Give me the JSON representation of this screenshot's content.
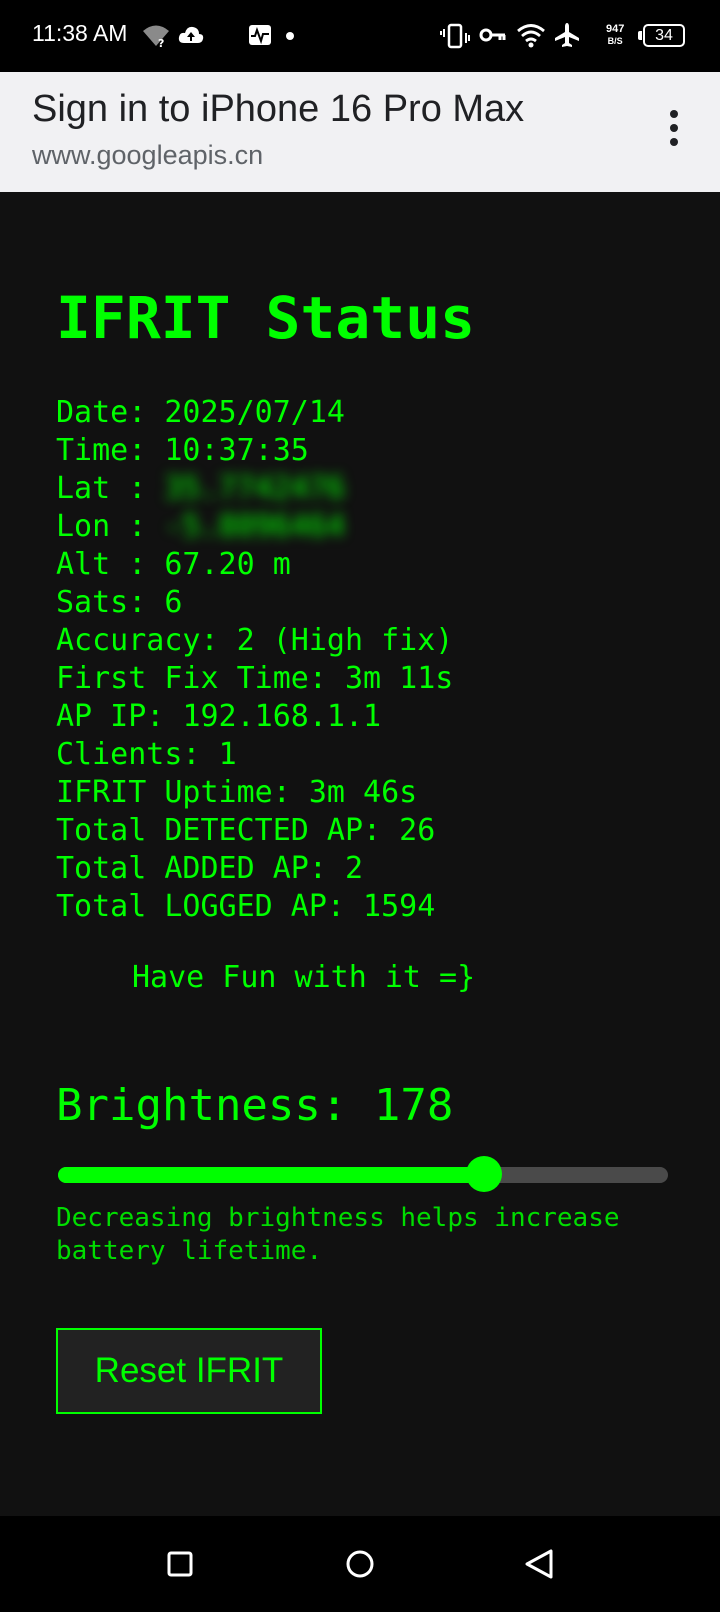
{
  "status_bar": {
    "time": "11:38 AM",
    "icons": [
      "wifi-question-icon",
      "cloud-upload-icon",
      "activity-icon",
      "dot-icon",
      "vibrate-icon",
      "vpn-key-icon",
      "wifi-icon",
      "airplane-icon"
    ],
    "net_speed_value": "947",
    "net_speed_unit": "B/S",
    "battery": "34"
  },
  "browser": {
    "title": "Sign in to iPhone 16 Pro Max",
    "url": "www.googleapis.cn",
    "menu_icon": "more-vert-icon"
  },
  "page": {
    "title": "IFRIT Status",
    "stats": [
      {
        "label": "Date: ",
        "value": "2025/07/14"
      },
      {
        "label": "Time: ",
        "value": "10:37:35"
      },
      {
        "label": "Lat : ",
        "value": "35.7742476"
      },
      {
        "label": "Lon : ",
        "value": "-5.8096464"
      },
      {
        "label": "Alt : ",
        "value": "67.20 m"
      },
      {
        "label": "Sats: ",
        "value": "6"
      },
      {
        "label": "Accuracy: ",
        "value": "2 (High fix)"
      },
      {
        "label": "First Fix Time: ",
        "value": "3m 11s"
      },
      {
        "label": "AP IP: ",
        "value": "192.168.1.1"
      },
      {
        "label": "Clients: ",
        "value": "1"
      },
      {
        "label": "IFRIT Uptime: ",
        "value": "3m 46s"
      },
      {
        "label": "Total DETECTED AP: ",
        "value": "26"
      },
      {
        "label": "Total ADDED AP: ",
        "value": "2"
      },
      {
        "label": "Total LOGGED AP: ",
        "value": "1594"
      }
    ],
    "fun_text": "Have Fun with it =}",
    "brightness_label": "Brightness: ",
    "brightness_value": "178",
    "brightness_max": 255,
    "hint": "Decreasing brightness helps increase battery lifetime.",
    "reset_label": "Reset IFRIT"
  },
  "colors": {
    "accent": "#00ff00",
    "background": "#111111"
  },
  "nav_bar": {
    "buttons": [
      "recents-square-icon",
      "home-circle-icon",
      "back-triangle-icon"
    ]
  }
}
